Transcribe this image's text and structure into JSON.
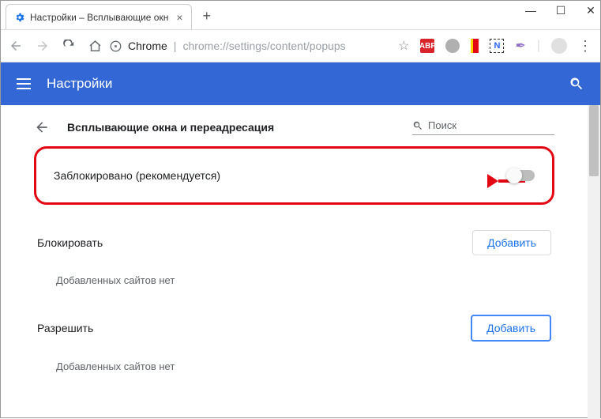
{
  "window": {
    "tab_title": "Настройки – Всплывающие окн",
    "minimize": "—",
    "maximize": "☐",
    "close": "✕",
    "newtab": "+"
  },
  "address": {
    "host": "Chrome",
    "path": "chrome://settings/content/popups"
  },
  "bluebar": {
    "title": "Настройки"
  },
  "page": {
    "heading": "Всплывающие окна и переадресация",
    "search_placeholder": "Поиск"
  },
  "main_toggle": {
    "label": "Заблокировано (рекомендуется)"
  },
  "block_section": {
    "title": "Блокировать",
    "add_label": "Добавить",
    "empty": "Добавленных сайтов нет"
  },
  "allow_section": {
    "title": "Разрешить",
    "add_label": "Добавить",
    "empty": "Добавленных сайтов нет"
  }
}
